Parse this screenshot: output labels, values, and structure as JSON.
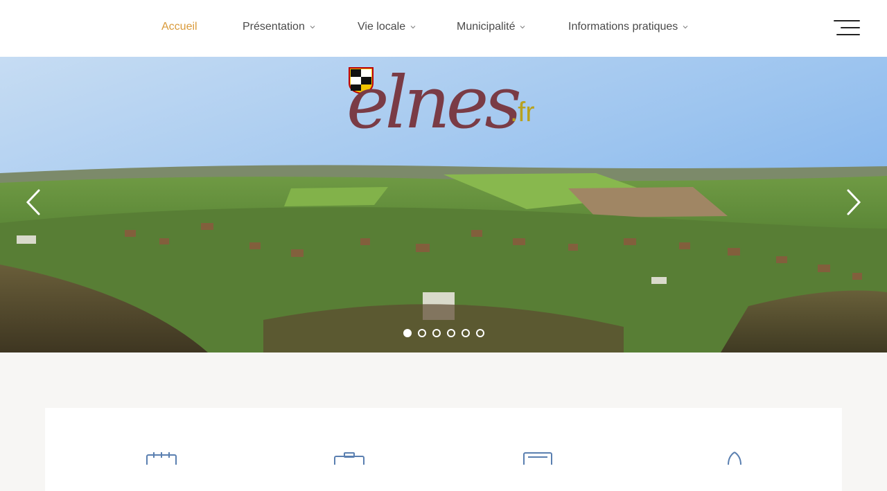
{
  "nav": {
    "items": [
      {
        "label": "Accueil",
        "active": true,
        "dropdown": false
      },
      {
        "label": "Présentation",
        "active": false,
        "dropdown": true
      },
      {
        "label": "Vie locale",
        "active": false,
        "dropdown": true
      },
      {
        "label": "Municipalité",
        "active": false,
        "dropdown": true
      },
      {
        "label": "Informations pratiques",
        "active": false,
        "dropdown": true
      }
    ],
    "menu_icon": "hamburger-icon"
  },
  "hero": {
    "logo": {
      "word": "elnes",
      "tld": ".fr"
    },
    "slide_count": 6,
    "active_slide": 1,
    "prev_icon": "chevron-left-icon",
    "next_icon": "chevron-right-icon"
  },
  "services": {
    "icons": [
      "calendar-icon",
      "briefcase-icon",
      "newspaper-icon",
      "bell-icon"
    ]
  },
  "colors": {
    "accent": "#d99a3a",
    "logo": "#7a3b45",
    "tld": "#b8a21e"
  }
}
